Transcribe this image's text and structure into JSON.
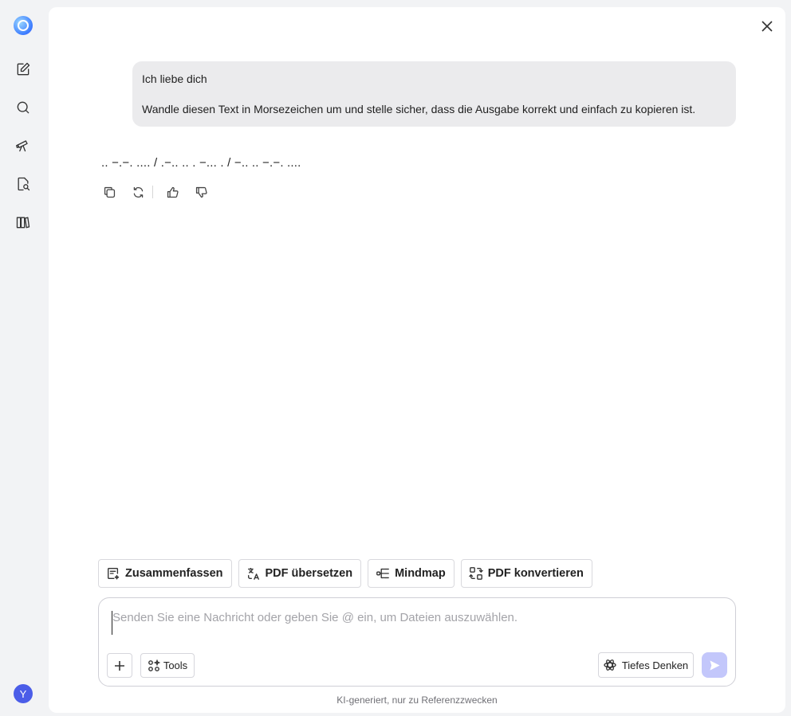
{
  "sidebar": {
    "items": [
      {
        "name": "new-chat",
        "icon": "edit-icon"
      },
      {
        "name": "search",
        "icon": "search-icon"
      },
      {
        "name": "discover",
        "icon": "telescope-icon"
      },
      {
        "name": "doc-search",
        "icon": "file-search-icon"
      },
      {
        "name": "library",
        "icon": "library-icon"
      }
    ],
    "avatar_initial": "Y"
  },
  "conversation": {
    "user_message": {
      "line1": "Ich liebe dich",
      "line2": "Wandle diesen Text in Morsezeichen um und stelle sicher, dass die Ausgabe korrekt und einfach zu kopieren ist."
    },
    "assistant_reply": ".. −.−. .... / .−.. .. . −... . / −.. .. −.−. ...."
  },
  "quick_actions": [
    {
      "label": "Zusammenfassen",
      "icon": "summarize-icon"
    },
    {
      "label": "PDF übersetzen",
      "icon": "translate-icon"
    },
    {
      "label": "Mindmap",
      "icon": "mindmap-icon"
    },
    {
      "label": "PDF konvertieren",
      "icon": "convert-icon"
    }
  ],
  "composer": {
    "placeholder": "Senden Sie eine Nachricht oder geben Sie @ ein, um Dateien auszuwählen.",
    "tools_label": "Tools",
    "deep_think_label": "Tiefes Denken"
  },
  "footer": {
    "disclaimer": "KI-generiert, nur zu Referenzzwecken"
  },
  "colors": {
    "accent": "#4b5de8",
    "send_disabled": "#c3c7fb",
    "bubble": "#ebebed"
  }
}
